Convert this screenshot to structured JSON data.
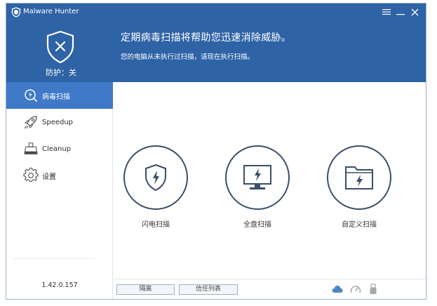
{
  "app": {
    "title": "Malware Hunter"
  },
  "window_controls": {
    "menu_icon": "menu-icon",
    "minimize_icon": "minimize-icon",
    "close_icon": "close-icon"
  },
  "protection": {
    "status_label": "防护：关",
    "icon": "shield-x-icon"
  },
  "banner": {
    "headline": "定期病毒扫描将帮助您迅速消除威胁。",
    "subline": "您的电脑从未执行过扫描，请现在执行扫描。"
  },
  "sidebar": {
    "items": [
      {
        "label": "病毒扫描",
        "icon": "scan-icon",
        "active": true
      },
      {
        "label": "Speedup",
        "icon": "rocket-icon",
        "active": false
      },
      {
        "label": "Cleanup",
        "icon": "broom-icon",
        "active": false
      },
      {
        "label": "设置",
        "icon": "gear-icon",
        "active": false
      }
    ],
    "version": "1.42.0.157"
  },
  "scan_options": [
    {
      "label": "闪电扫描",
      "icon": "shield-bolt-icon"
    },
    {
      "label": "全盘扫描",
      "icon": "monitor-bolt-icon"
    },
    {
      "label": "自定义扫描",
      "icon": "folder-bolt-icon"
    }
  ],
  "bottom_bar": {
    "quarantine_label": "隔离",
    "trust_list_label": "信任列表",
    "icons": [
      "cloud-icon",
      "gauge-icon",
      "usb-icon"
    ]
  },
  "colors": {
    "header_blue": "#2e63a6",
    "active_nav": "#3f79c8",
    "circle_border": "#3a4e66"
  }
}
